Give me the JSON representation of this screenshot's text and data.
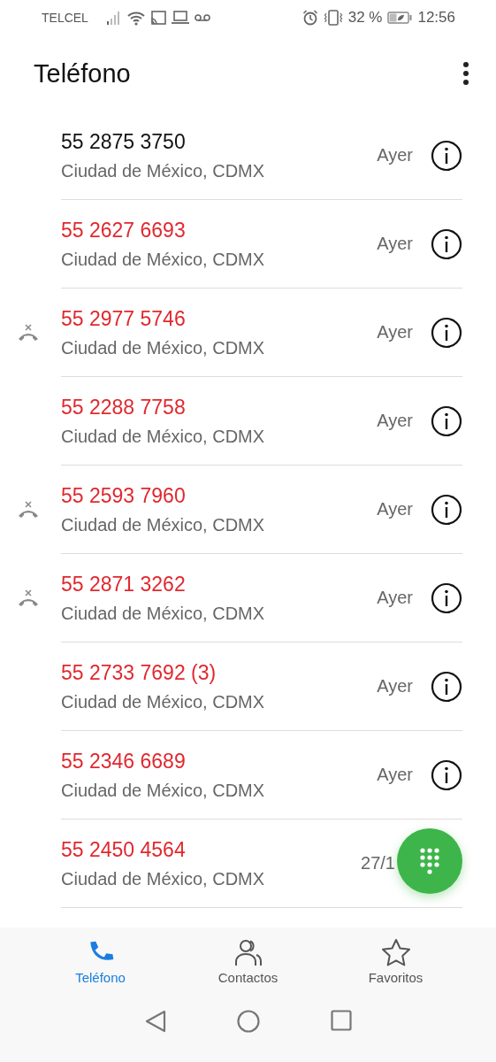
{
  "status_bar": {
    "carrier": "TELCEL",
    "battery_percent": "32 %",
    "time": "12:56"
  },
  "app_bar": {
    "title": "Teléfono"
  },
  "calls": [
    {
      "number": "55 2875 3750",
      "location": "Ciudad de México, CDMX",
      "time": "Ayer",
      "missed": false,
      "rejected": false,
      "info": true
    },
    {
      "number": "55 2627 6693",
      "location": "Ciudad de México, CDMX",
      "time": "Ayer",
      "missed": true,
      "rejected": false,
      "info": true
    },
    {
      "number": "55 2977 5746",
      "location": "Ciudad de México, CDMX",
      "time": "Ayer",
      "missed": true,
      "rejected": true,
      "info": true
    },
    {
      "number": "55 2288 7758",
      "location": "Ciudad de México, CDMX",
      "time": "Ayer",
      "missed": true,
      "rejected": false,
      "info": true
    },
    {
      "number": "55 2593 7960",
      "location": "Ciudad de México, CDMX",
      "time": "Ayer",
      "missed": true,
      "rejected": true,
      "info": true
    },
    {
      "number": "55 2871 3262",
      "location": "Ciudad de México, CDMX",
      "time": "Ayer",
      "missed": true,
      "rejected": true,
      "info": true
    },
    {
      "number": "55 2733 7692 (3)",
      "location": "Ciudad de México, CDMX",
      "time": "Ayer",
      "missed": true,
      "rejected": false,
      "info": true
    },
    {
      "number": "55 2346 6689",
      "location": "Ciudad de México, CDMX",
      "time": "Ayer",
      "missed": true,
      "rejected": false,
      "info": true
    },
    {
      "number": "55 2450 4564",
      "location": "Ciudad de México, CDMX",
      "time": "27/1",
      "missed": true,
      "rejected": false,
      "info": false
    }
  ],
  "bottom_nav": [
    {
      "kind": "phone",
      "label": "Teléfono",
      "selected": true
    },
    {
      "kind": "contacts",
      "label": "Contactos",
      "selected": false
    },
    {
      "kind": "star",
      "label": "Favoritos",
      "selected": false
    }
  ]
}
